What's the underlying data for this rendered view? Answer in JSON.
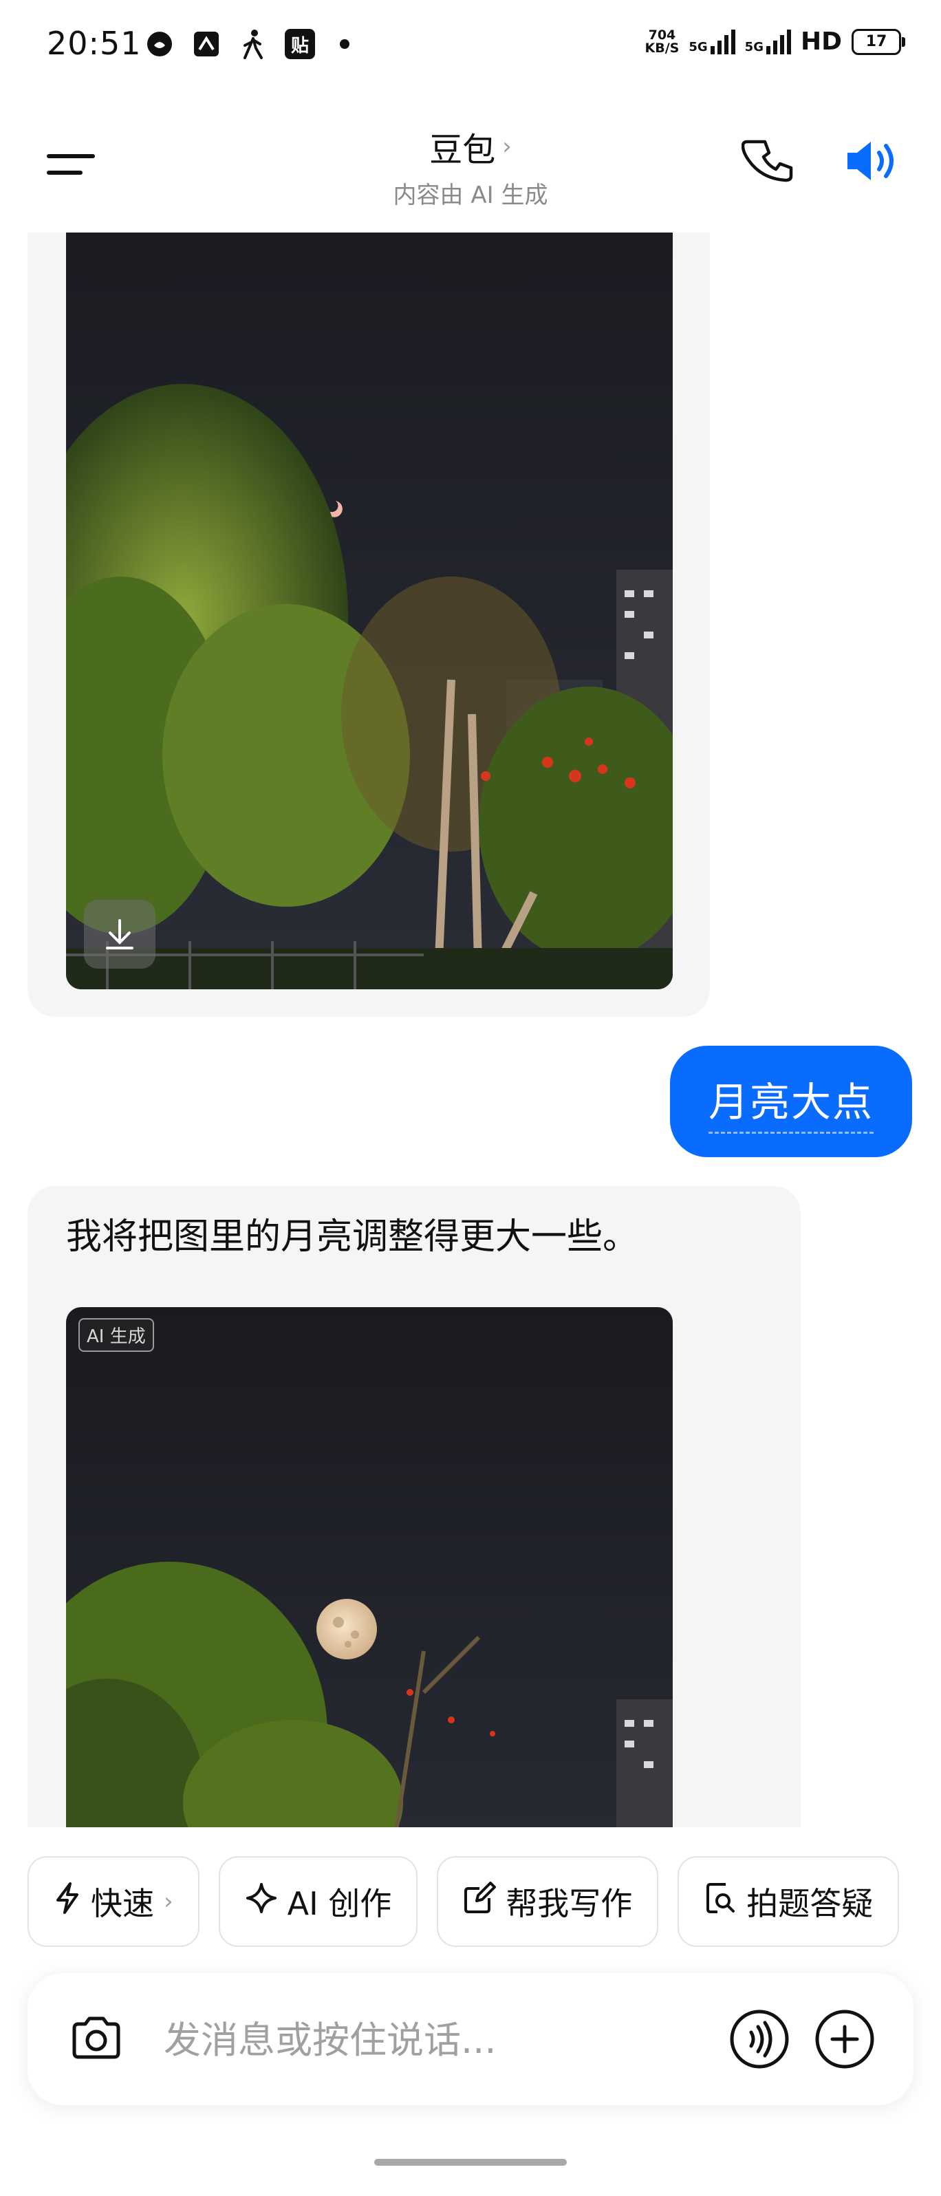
{
  "status_bar": {
    "time": "20:51",
    "left_icons": [
      "carrot-app-icon",
      "nfc-icon",
      "walking-icon",
      "sticker-app-icon"
    ],
    "sticker_label": "贴",
    "speed_value": "704",
    "speed_unit": "KB/S",
    "net1": "5G",
    "net2": "5G",
    "hd": "HD",
    "battery": "17"
  },
  "header": {
    "title": "豆包",
    "subtitle": "内容由 AI 生成",
    "title_chevron": "›"
  },
  "chat": {
    "user_message": "月亮大点",
    "ai_reply_text": "我将把图里的月亮调整得更大一些。",
    "ai_badge": "AI 生成"
  },
  "quick_actions": [
    {
      "label": "快速",
      "icon": "lightning-icon",
      "chevron": "›"
    },
    {
      "label": "AI 创作",
      "icon": "sparkle-icon"
    },
    {
      "label": "帮我写作",
      "icon": "edit-icon"
    },
    {
      "label": "拍题答疑",
      "icon": "search-doc-icon"
    }
  ],
  "input": {
    "placeholder": "发消息或按住说话..."
  },
  "colors": {
    "accent": "#0a6cff",
    "bubble_bg": "#f5f5f5"
  }
}
